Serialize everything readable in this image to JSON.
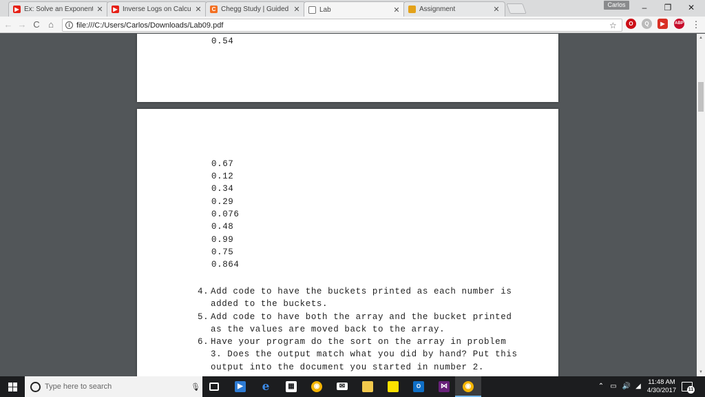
{
  "tabs": [
    {
      "title": "Ex: Solve an Exponential",
      "favicon": "youtube-icon",
      "color": "#e62117"
    },
    {
      "title": "Inverse Logs on Calculat",
      "favicon": "youtube-icon",
      "color": "#e62117"
    },
    {
      "title": "Chegg Study | Guided So",
      "favicon": "chegg-icon",
      "color": "#f36f21"
    },
    {
      "title": "Lab",
      "favicon": "document-icon",
      "color": "#888888"
    },
    {
      "title": "Assignment",
      "favicon": "assignment-icon",
      "color": "#e3a21a"
    }
  ],
  "window": {
    "profile": "Carlos",
    "minimize": "–",
    "restore": "❐",
    "close": "✕"
  },
  "toolbar": {
    "url": "file:///C:/Users/Carlos/Downloads/Lab09.pdf",
    "back": "←",
    "forward": "→",
    "reload": "C",
    "home": "⌂",
    "star": "☆",
    "menu": "⋮",
    "abp": "ABP"
  },
  "document": {
    "page1_values": [
      "0.54"
    ],
    "page2_values": [
      "0.67",
      "0.12",
      "0.34",
      "0.29",
      "0.076",
      "0.48",
      "0.99",
      "0.75",
      "0.864"
    ],
    "items": [
      {
        "num": "4.",
        "text": "Add code to have the buckets printed as each number is added to the buckets."
      },
      {
        "num": "5.",
        "text": "Add code to have both the array and the bucket printed as the values are moved back to the array."
      },
      {
        "num": "6.",
        "text": "Have your program do the sort on the array in problem 3. Does the output match what you did by hand? Put this output into the document you started in number 2."
      }
    ]
  },
  "taskbar": {
    "search_placeholder": "Type here to search",
    "time": "11:48 AM",
    "date": "4/30/2017",
    "notification_count": "11",
    "apps": [
      "task-view-icon",
      "media-player-icon",
      "edge-icon",
      "store-icon",
      "chrome-icon",
      "mail-icon",
      "file-explorer-icon",
      "sticky-notes-icon",
      "outlook-icon",
      "visual-studio-icon",
      "chrome-active-icon"
    ]
  }
}
